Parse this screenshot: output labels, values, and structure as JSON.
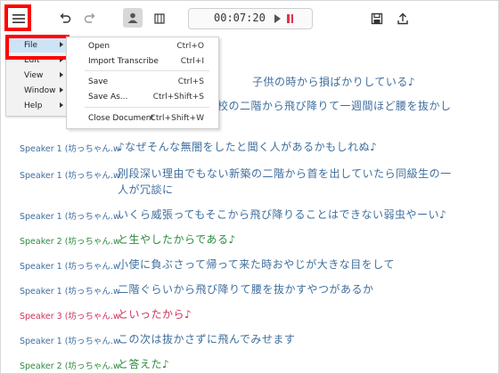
{
  "toolbar": {
    "menu_icon": "hamburger-icon",
    "undo_icon": "undo-icon",
    "redo_icon": "redo-icon",
    "speaker_icon": "person-icon",
    "segment_icon": "film-icon",
    "time": "00:07:20",
    "save_icon": "save-icon",
    "export_icon": "upload-icon"
  },
  "main_menu": {
    "items": [
      {
        "label": "File"
      },
      {
        "label": "Edit"
      },
      {
        "label": "View"
      },
      {
        "label": "Window"
      },
      {
        "label": "Help"
      }
    ]
  },
  "file_menu": {
    "items": [
      {
        "label": "Open",
        "shortcut": "Ctrl+O"
      },
      {
        "label": "Import  Transcribe",
        "shortcut": "Ctrl+I"
      },
      {
        "label": "Save",
        "shortcut": "Ctrl+S"
      },
      {
        "label": "Save As...",
        "shortcut": "Ctrl+Shift+S"
      },
      {
        "label": "Close Document",
        "shortcut": "Ctrl+Shift+W"
      }
    ]
  },
  "transcript": {
    "partial_lines": [
      "子供の時から損ばかりしている♪",
      "校の二階から飛び降りて一週間ほど腰を抜かし"
    ],
    "rows": [
      {
        "speaker": "Speaker 1 (坊っちゃん.w",
        "text": "♪なぜそんな無闇をしたと聞く人があるかもしれぬ♪",
        "color": "#3f6e9e"
      },
      {
        "speaker": "Speaker 1 (坊っちゃん.w",
        "text": "別段深い理由でもない新築の二階から首を出していたら同級生の一",
        "text2": "人が冗談に",
        "color": "#3f6e9e"
      },
      {
        "speaker": "Speaker 1 (坊っちゃん.w",
        "text": "いくら威張ってもそこから飛び降りることはできない弱虫やーい♪",
        "color": "#3f6e9e"
      },
      {
        "speaker": "Speaker 2 (坊っちゃん.w",
        "text": "と生やしたからである♪",
        "color": "#2e8b3e"
      },
      {
        "speaker": "Speaker 1 (坊っちゃん.w",
        "text": "小使に負ぶさって帰って来た時おやじが大きな目をして",
        "color": "#3f6e9e"
      },
      {
        "speaker": "Speaker 1 (坊っちゃん.w",
        "text": "二階ぐらいから飛び降りて腰を抜かすやつがあるか",
        "color": "#3f6e9e"
      },
      {
        "speaker": "Speaker 3 (坊っちゃん.w",
        "text": "といったから♪",
        "color": "#d1305c"
      },
      {
        "speaker": "Speaker 1 (坊っちゃん.w",
        "text": "この次は抜かさずに飛んでみせます",
        "color": "#3f6e9e"
      },
      {
        "speaker": "Speaker 2 (坊っちゃん.w",
        "text": "と答えた♪",
        "color": "#2e8b3e"
      }
    ]
  }
}
